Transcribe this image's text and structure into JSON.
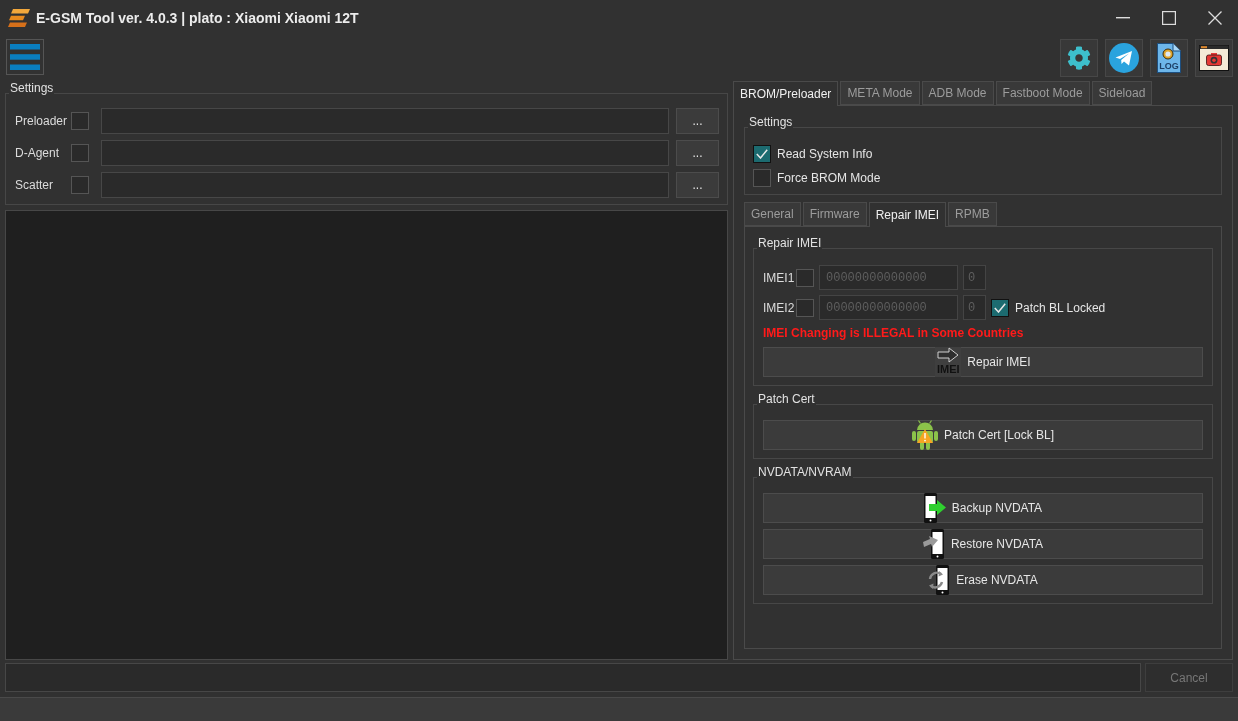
{
  "window": {
    "title": "E-GSM Tool ver. 4.0.3 | plato : Xiaomi Xiaomi 12T"
  },
  "toolbar": [
    {
      "kind": "settings"
    },
    {
      "kind": "telegram"
    },
    {
      "kind": "log",
      "label": "LOG"
    },
    {
      "kind": "screenshot"
    }
  ],
  "file_settings": {
    "title": "Settings",
    "rows": [
      {
        "label": "Preloader",
        "checked": false,
        "browse_button": "..."
      },
      {
        "label": "D-Agent",
        "checked": false,
        "browse_button": "..."
      },
      {
        "label": "Scatter",
        "checked": false,
        "browse_button": "..."
      }
    ]
  },
  "mode_tabs": [
    {
      "label": "BROM/Preloader",
      "selected": true
    },
    {
      "label": "META Mode",
      "selected": false
    },
    {
      "label": "ADB Mode",
      "selected": false
    },
    {
      "label": "Fastboot Mode",
      "selected": false
    },
    {
      "label": "Sideload",
      "selected": false
    }
  ],
  "brom_settings": {
    "title": "Settings",
    "options": [
      {
        "label": "Read System Info",
        "checked": true
      },
      {
        "label": "Force BROM Mode",
        "checked": false
      }
    ]
  },
  "function_tabs": [
    {
      "label": "General",
      "selected": false
    },
    {
      "label": "Firmware",
      "selected": false
    },
    {
      "label": "Repair IMEI",
      "selected": true
    },
    {
      "label": "RPMB",
      "selected": false
    }
  ],
  "repair_imei": {
    "title": "Repair IMEI",
    "imei_fields": [
      {
        "label": "IMEI1",
        "checked": false,
        "placeholder": "00000000000000",
        "check_digit_placeholder": "0"
      },
      {
        "label": "IMEI2",
        "checked": false,
        "placeholder": "00000000000000",
        "check_digit_placeholder": "0"
      }
    ],
    "patch_bl_locked": {
      "label": "Patch BL Locked",
      "checked": true
    },
    "warning": "IMEI Changing is ILLEGAL in Some Countries",
    "button": {
      "label": "Repair IMEI",
      "icon_caption": "IMEI"
    }
  },
  "patch_cert": {
    "title": "Patch Cert",
    "button": {
      "label": "Patch Cert [Lock BL]"
    }
  },
  "nvdata": {
    "title": "NVDATA/NVRAM",
    "buttons": [
      {
        "kind": "backup",
        "label": "Backup NVDATA"
      },
      {
        "kind": "restore",
        "label": "Restore NVDATA"
      },
      {
        "kind": "erase",
        "label": "Erase NVDATA"
      }
    ]
  },
  "cancel_button": {
    "label": "Cancel",
    "disabled": true
  }
}
